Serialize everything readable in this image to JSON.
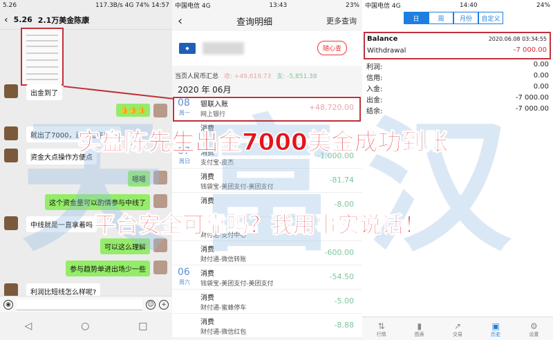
{
  "chat": {
    "status": {
      "time": "5.26",
      "net": "117.3B/s",
      "signal": "4G",
      "battery": "74%",
      "clock": "14:57"
    },
    "title": "2.1万美金陈康",
    "messages": [
      {
        "side": "left",
        "text": "出金到了"
      },
      {
        "side": "right",
        "text": "👍👍👍"
      },
      {
        "side": "left",
        "text": "就出了7000，还有些在里面"
      },
      {
        "side": "left",
        "text": "资金大点操作方便点"
      },
      {
        "side": "right",
        "text": "嗯嗯"
      },
      {
        "side": "right",
        "text": "这个资金量可以酌情参与中线了"
      },
      {
        "side": "left",
        "text": "中线就是一直拿着吗"
      },
      {
        "side": "right",
        "text": "可以这么理解"
      },
      {
        "side": "right",
        "text": "参与趋势单进出场少一些"
      },
      {
        "side": "left",
        "text": "利润比短线怎么样呢?"
      }
    ]
  },
  "bank": {
    "status": {
      "carrier": "中国电信",
      "net": "4G",
      "clock": "13:43",
      "battery": "23%"
    },
    "title": "查询明细",
    "more": "更多查询",
    "card_btn": "随心查",
    "summary": {
      "label": "当页人民币汇总",
      "income": "收: +49,619.73",
      "expense": "支: -5,851.38"
    },
    "month": "2020 年 06月",
    "transactions": [
      {
        "date": "08",
        "wk": "周一",
        "t1": "银联入账",
        "t2": "网上银行",
        "amt": "+48,720.00",
        "type": "pos"
      },
      {
        "date": "",
        "wk": "",
        "t1": "消费",
        "t2": "",
        "amt": "",
        "type": "neg"
      },
      {
        "date": "07",
        "wk": "周日",
        "t1": "消费",
        "t2": "支付宝-皮杰",
        "amt": "-1,000.00",
        "type": "neg"
      },
      {
        "date": "",
        "wk": "",
        "t1": "消费",
        "t2": "钱袋宝-美团支付-美团支付",
        "amt": "-81.74",
        "type": "neg"
      },
      {
        "date": "",
        "wk": "",
        "t1": "消费",
        "t2": "",
        "amt": "-8.00",
        "type": "neg"
      },
      {
        "date": "",
        "wk": "",
        "t1": "",
        "t2": "财付通-支付中心",
        "amt": "",
        "type": "neg"
      },
      {
        "date": "",
        "wk": "",
        "t1": "消费",
        "t2": "财付通-微信转账",
        "amt": "-600.00",
        "type": "neg"
      },
      {
        "date": "06",
        "wk": "周六",
        "t1": "消费",
        "t2": "钱袋宝-美团支付-美团支付",
        "amt": "-54.50",
        "type": "neg"
      },
      {
        "date": "",
        "wk": "",
        "t1": "消费",
        "t2": "财付通-蜜蜂停车",
        "amt": "-5.00",
        "type": "neg"
      },
      {
        "date": "",
        "wk": "",
        "t1": "消费",
        "t2": "财付通-微信红包",
        "amt": "-8.88",
        "type": "neg"
      }
    ]
  },
  "trade": {
    "status": {
      "carrier": "中国电信",
      "net": "4G",
      "clock": "14:40",
      "battery": "24%"
    },
    "tabs": [
      "日",
      "周",
      "月份",
      "自定义"
    ],
    "balance": {
      "title": "Balance",
      "date": "2020.06.08 03:34:55",
      "type": "Withdrawal",
      "amount": "-7 000.00"
    },
    "stats": [
      {
        "k": "利润:",
        "v": "0.00"
      },
      {
        "k": "信用:",
        "v": "0.00"
      },
      {
        "k": "入金:",
        "v": "0.00"
      },
      {
        "k": "出金:",
        "v": "-7 000.00"
      },
      {
        "k": "结余:",
        "v": "-7 000.00"
      }
    ],
    "tabbar": [
      {
        "label": "行情",
        "icon": "quotes-icon"
      },
      {
        "label": "图表",
        "icon": "chart-icon"
      },
      {
        "label": "交易",
        "icon": "trade-icon"
      },
      {
        "label": "历史",
        "icon": "history-icon"
      },
      {
        "label": "设置",
        "icon": "settings-icon"
      }
    ]
  },
  "overlay": {
    "watermark": "天富汉",
    "headline1": "实盘陈先生出金7000美金成功到账",
    "headline2": "平台安全可靠吗？我用事实说话！"
  }
}
